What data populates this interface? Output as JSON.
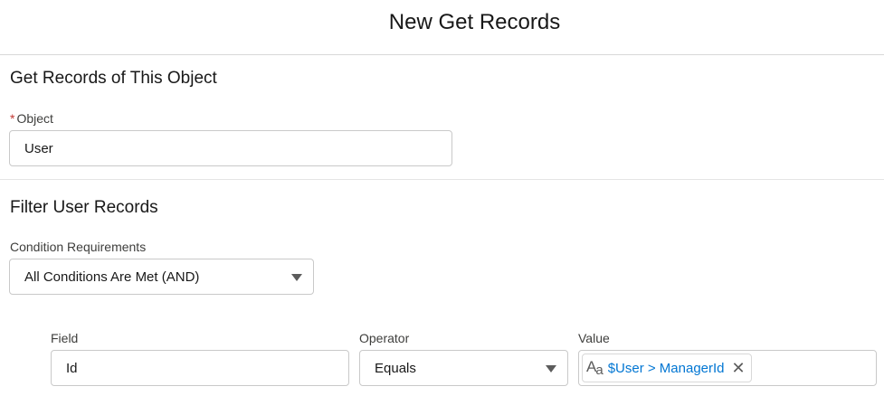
{
  "header": {
    "title": "New Get Records"
  },
  "object_section": {
    "title": "Get Records of This Object",
    "object_label": "Object",
    "required_marker": "*",
    "object_value": "User"
  },
  "filter_section": {
    "title": "Filter User Records",
    "condition_label": "Condition Requirements",
    "condition_value": "All Conditions Are Met (AND)"
  },
  "condition_row": {
    "field_label": "Field",
    "field_value": "Id",
    "operator_label": "Operator",
    "operator_value": "Equals",
    "value_label": "Value",
    "value_icon_a": "A",
    "value_icon_sub": "a",
    "value_pill": "$User > ManagerId"
  }
}
